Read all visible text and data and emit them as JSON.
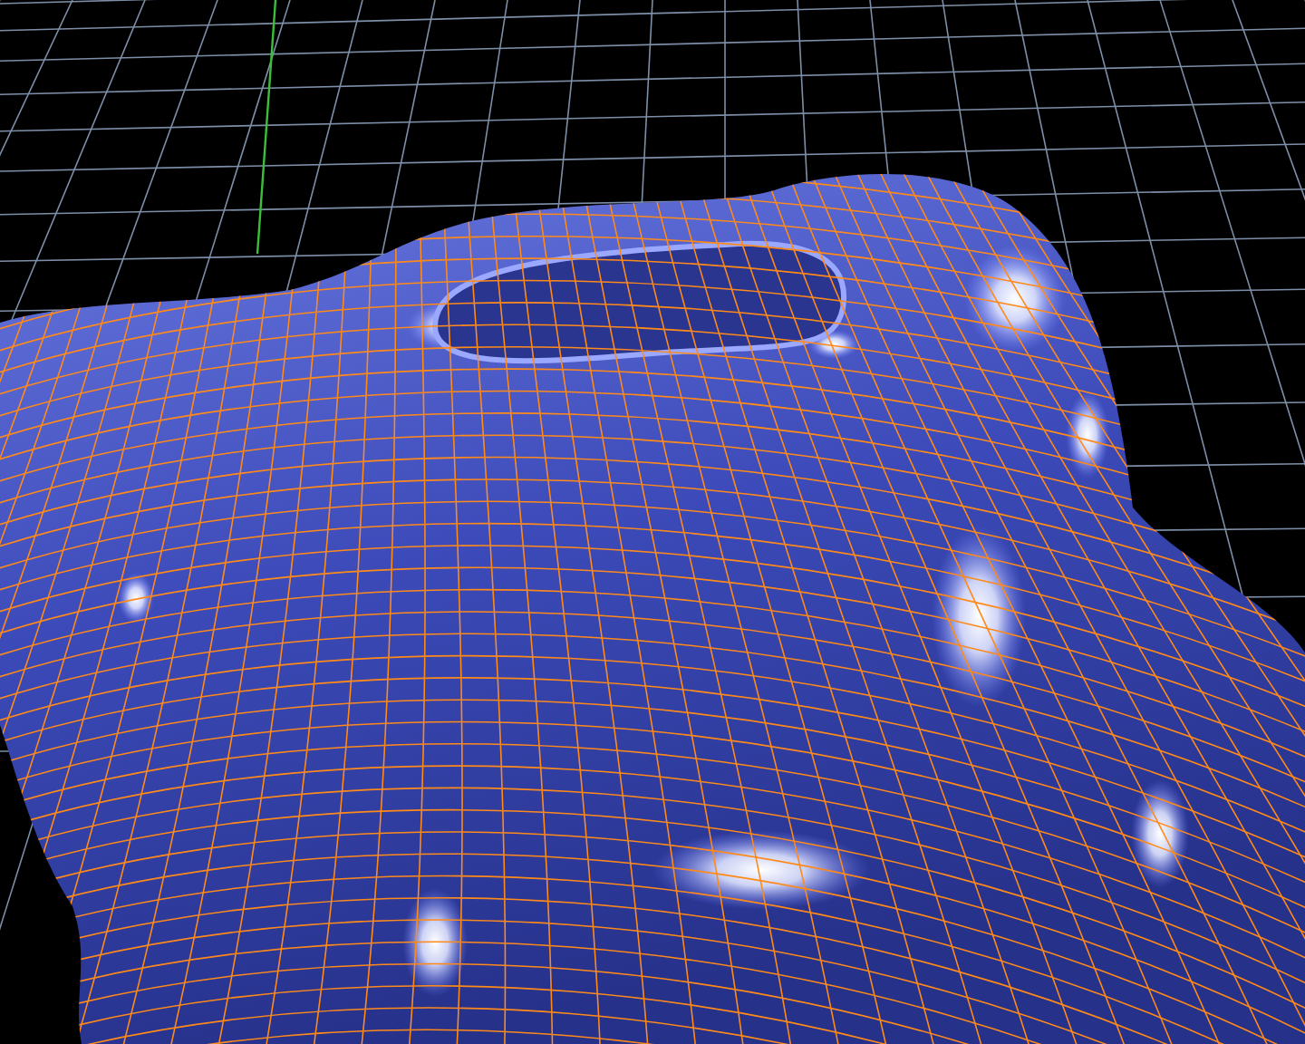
{
  "viewport": {
    "grid": true,
    "wireframe_overlay": true
  }
}
